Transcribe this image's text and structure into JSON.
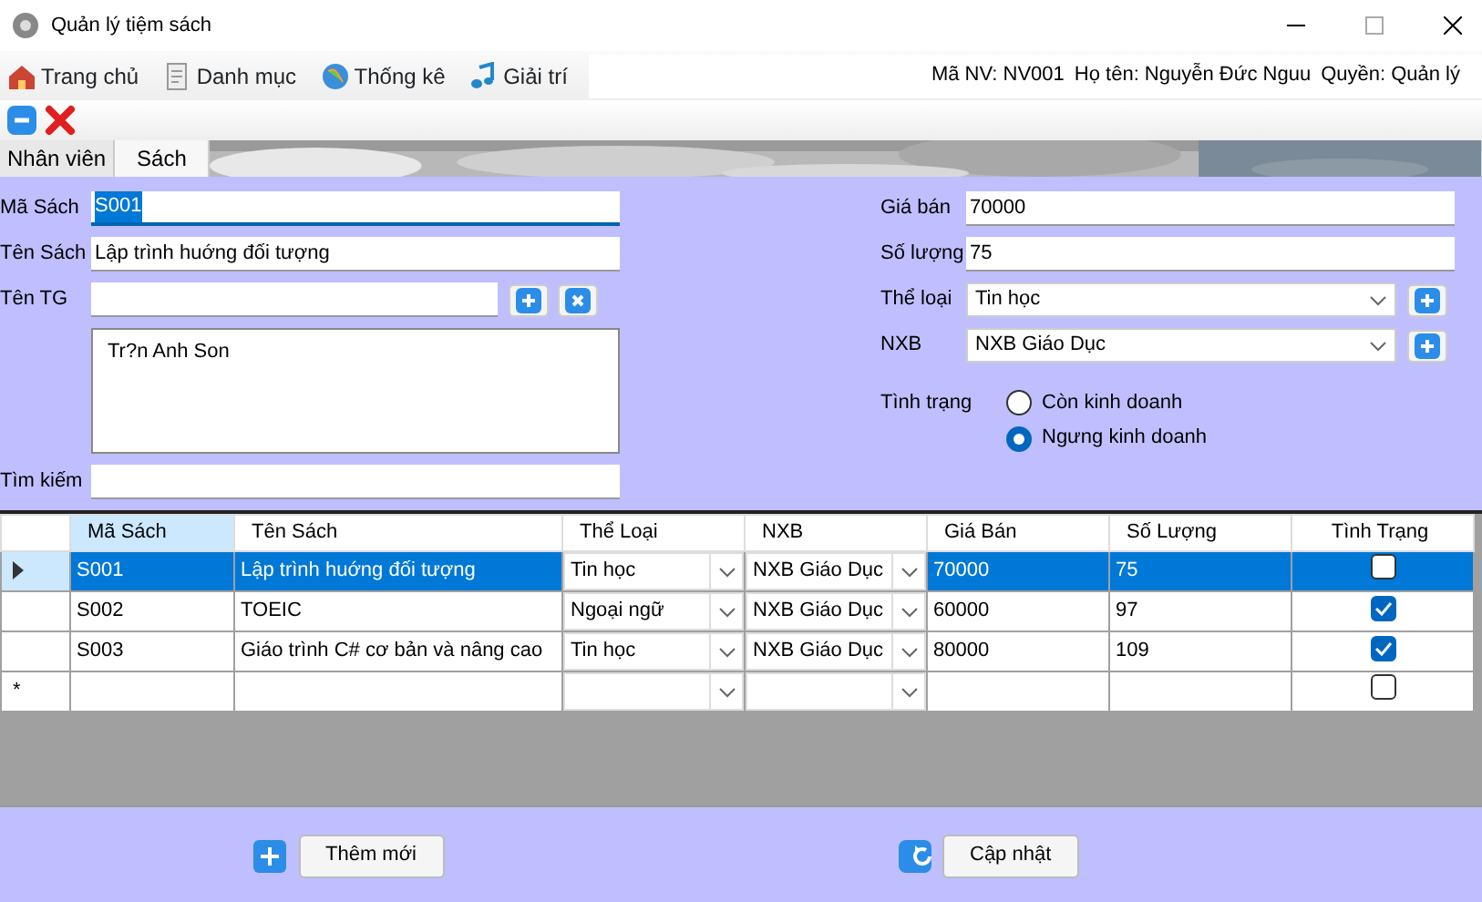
{
  "window": {
    "title": "Quản lý tiệm sách"
  },
  "menu": [
    {
      "label": "Trang chủ",
      "kind": "home"
    },
    {
      "label": "Danh mục",
      "kind": "notes"
    },
    {
      "label": "Thống kê",
      "kind": "globe"
    },
    {
      "label": "Giải trí",
      "kind": "music"
    }
  ],
  "user_info": [
    "Mã NV: NV001",
    "Họ tên: Nguyễn Đức Nguu",
    "Quyền: Quản lý"
  ],
  "tabs": [
    {
      "label": "Nhân viên",
      "selected": false
    },
    {
      "label": "Sách",
      "selected": true
    }
  ],
  "form": {
    "left": [
      {
        "kind": "text",
        "label": "Mã Sách",
        "value": "S001",
        "focused": true
      },
      {
        "kind": "text",
        "label": "Tên Sách",
        "value": "Lập trình huớng đối tượng",
        "focused": false
      },
      {
        "kind": "author",
        "label": "Tên TG"
      },
      {
        "kind": "list",
        "items": [
          "Tr?n Anh Son"
        ]
      },
      {
        "kind": "text",
        "label": "Tìm kiếm",
        "focused": false
      }
    ],
    "right": [
      {
        "kind": "text",
        "label": "Giá bán",
        "value": "70000",
        "focused": false
      },
      {
        "kind": "text",
        "label": "Số lượng",
        "value": "75",
        "focused": false
      },
      {
        "kind": "combo",
        "label": "Thể loại",
        "value": "Tin học"
      },
      {
        "kind": "combo",
        "label": "NXB",
        "value": "NXB Giáo Dục"
      },
      {
        "kind": "radio",
        "label": "Tình trạng",
        "options": [
          {
            "label": "Còn kinh doanh",
            "selected": false
          },
          {
            "label": "Ngưng kinh doanh",
            "selected": true
          }
        ]
      }
    ]
  },
  "table": {
    "columns": [
      {
        "label": "Mã Sách",
        "kind": "text",
        "selected": true
      },
      {
        "label": "Tên Sách",
        "kind": "text",
        "selected": false
      },
      {
        "label": "Thể Loại",
        "kind": "combo",
        "selected": false
      },
      {
        "label": "NXB",
        "kind": "combo",
        "selected": false
      },
      {
        "label": "Giá Bán",
        "kind": "text",
        "selected": false
      },
      {
        "label": "Số Lượng",
        "kind": "text",
        "selected": false
      },
      {
        "label": "Tình Trạng",
        "kind": "check",
        "selected": false
      }
    ],
    "rows": [
      {
        "kind": "data",
        "selected": true,
        "cells": [
          "S001",
          "Lập trình huớng đối tượng",
          "Tin học",
          "NXB Giáo Dục",
          "70000",
          "75"
        ],
        "checked": false
      },
      {
        "kind": "data",
        "selected": false,
        "cells": [
          "S002",
          "TOEIC",
          "Ngoại ngữ",
          "NXB Giáo Dục",
          "60000",
          "97"
        ],
        "checked": true
      },
      {
        "kind": "data",
        "selected": false,
        "cells": [
          "S003",
          "Giáo trình C# cơ bản và nâng cao",
          "Tin học",
          "NXB Giáo Dục",
          "80000",
          "109"
        ],
        "checked": true
      },
      {
        "kind": "new",
        "marker": "*",
        "selected": false,
        "checked": false
      }
    ]
  },
  "buttons": [
    {
      "label": "Thêm mới",
      "kind": "add"
    },
    {
      "label": "Cập nhật",
      "kind": "refresh"
    }
  ]
}
